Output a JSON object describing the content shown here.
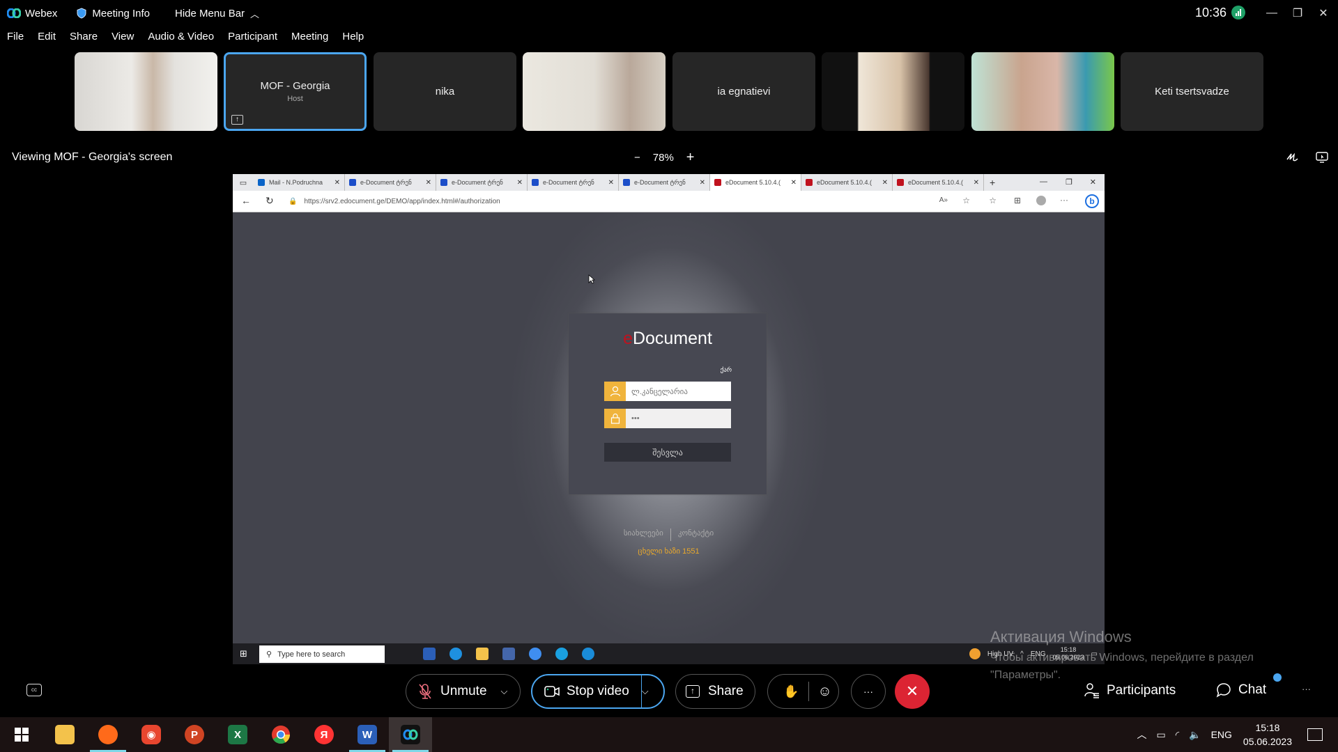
{
  "titlebar": {
    "app_name": "Webex",
    "meeting_info": "Meeting Info",
    "hide_menu_bar": "Hide Menu Bar",
    "time": "10:36",
    "minimize": "—",
    "restore": "❐",
    "close": "✕"
  },
  "menubar": {
    "items": [
      "File",
      "Edit",
      "Share",
      "View",
      "Audio & Video",
      "Participant",
      "Meeting",
      "Help"
    ]
  },
  "participants": [
    {
      "name": "",
      "type": "video"
    },
    {
      "name": "MOF - Georgia",
      "role": "Host",
      "type": "name",
      "active": true
    },
    {
      "name": "nika",
      "type": "name"
    },
    {
      "name": "",
      "type": "video"
    },
    {
      "name": "ia egnatievi",
      "type": "name"
    },
    {
      "name": "",
      "type": "video"
    },
    {
      "name": "",
      "type": "video"
    },
    {
      "name": "Keti tsertsvadze",
      "type": "name"
    }
  ],
  "viewing": {
    "label": "Viewing MOF - Georgia's screen",
    "zoom_minus": "−",
    "zoom_level": "78%",
    "zoom_plus": "+"
  },
  "shared_screen": {
    "browser": {
      "tabs": [
        {
          "label": "Mail - N.Podruchna",
          "favicon_color": "#0a64c8"
        },
        {
          "label": "e-Document ტრენ",
          "favicon_color": "#1c4ec9"
        },
        {
          "label": "e-Document ტრენ",
          "favicon_color": "#1c4ec9"
        },
        {
          "label": "e-Document ტრენ",
          "favicon_color": "#1c4ec9"
        },
        {
          "label": "e-Document ტრენ",
          "favicon_color": "#1c4ec9"
        },
        {
          "label": "eDocument 5.10.4.(",
          "favicon_color": "#c0121e",
          "selected": true
        },
        {
          "label": "eDocument 5.10.4.(",
          "favicon_color": "#c0121e"
        },
        {
          "label": "eDocument 5.10.4.(",
          "favicon_color": "#c0121e"
        }
      ],
      "new_tab": "+",
      "url": "https://srv2.edocument.ge/DEMO/app/index.html#/authorization"
    },
    "login": {
      "logo_e": "e",
      "logo_rest": "Document",
      "language": "ქარ",
      "username": "ლ.კანცელარია",
      "password": "•••",
      "submit": "შესვლა"
    },
    "footer": {
      "news": "სიახლეები",
      "contact": "კონტაქტი",
      "hotline": "ცხელი ხაზი 1551"
    },
    "inner_taskbar": {
      "search_placeholder": "Type here to search",
      "weather": "High UV",
      "lang": "ENG",
      "time": "15:18",
      "date": "05.06.2023"
    }
  },
  "activation": {
    "title": "Активация Windows",
    "message": "Чтобы активировать Windows, перейдите в раздел \"Параметры\"."
  },
  "controls": {
    "unmute": "Unmute",
    "stop_video": "Stop video",
    "share": "Share",
    "more": "···",
    "end": "✕",
    "participants": "Participants",
    "chat": "Chat",
    "overflow": "···"
  },
  "taskbar": {
    "apps": [
      {
        "name": "file-explorer",
        "color": "#f3c24b",
        "glyph": "▬"
      },
      {
        "name": "firefox",
        "color": "#ff6a1a",
        "glyph": "●",
        "running": true
      },
      {
        "name": "foxit-reader",
        "color": "#e8462f",
        "glyph": "◉"
      },
      {
        "name": "powerpoint",
        "color": "#d04423",
        "glyph": "P"
      },
      {
        "name": "excel",
        "color": "#1d7745",
        "glyph": "X"
      },
      {
        "name": "chrome",
        "color": "#3f8ef0",
        "glyph": "◎"
      },
      {
        "name": "yandex",
        "color": "#f33",
        "glyph": "Я"
      },
      {
        "name": "word",
        "color": "#2b5fb8",
        "glyph": "W",
        "running": true
      },
      {
        "name": "webex",
        "color": "#1a1a1a",
        "glyph": "W",
        "running": true,
        "current": true
      }
    ],
    "lang": "ENG",
    "time": "15:18",
    "date": "05.06.2023"
  }
}
